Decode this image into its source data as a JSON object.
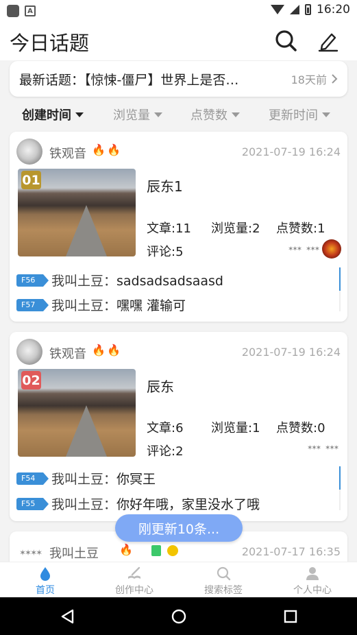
{
  "status": {
    "time": "16:20"
  },
  "header": {
    "title": "今日话题",
    "search_icon": "search-icon",
    "edit_icon": "pencil-icon"
  },
  "notice": {
    "text": "最新话题：【惊悚-僵尸】世界上是否…",
    "time": "18天前"
  },
  "sort": {
    "items": [
      "创建时间",
      "浏览量",
      "点赞数",
      "更新时间"
    ],
    "active": "创建时间"
  },
  "cards": [
    {
      "author": "铁观音",
      "date": "2021-07-19 16:24",
      "rank": "01",
      "rank_color": "#b8962e",
      "title": "辰东1",
      "articles": "文章:11",
      "views": "浏览量:2",
      "likes": "点赞数:1",
      "comments": "评论:5",
      "floors": [
        {
          "tag": "F56",
          "who": "我叫土豆：",
          "text": "sadsadsadsaasd"
        },
        {
          "tag": "F57",
          "who": "我叫土豆：",
          "text": "嘿嘿 灌输可"
        }
      ]
    },
    {
      "author": "铁观音",
      "date": "2021-07-19 16:24",
      "rank": "02",
      "rank_color": "#e05a5a",
      "title": "辰东",
      "articles": "文章:6",
      "views": "浏览量:1",
      "likes": "点赞数:0",
      "comments": "评论:2",
      "floors": [
        {
          "tag": "F54",
          "who": "我叫土豆：",
          "text": "你冥王"
        },
        {
          "tag": "F55",
          "who": "我叫土豆：",
          "text": "你好年哦，家里没水了哦"
        }
      ]
    },
    {
      "author": "我叫土豆",
      "date": "2021-07-17 16:35"
    }
  ],
  "toast": "刚更新10条...",
  "tabs": [
    {
      "label": "首页",
      "icon": "drop-icon"
    },
    {
      "label": "创作中心",
      "icon": "book-pen-icon"
    },
    {
      "label": "搜索标签",
      "icon": "search-icon"
    },
    {
      "label": "个人中心",
      "icon": "person-icon"
    }
  ],
  "colors": {
    "accent": "#2f8be0",
    "toast": "#7fa9f5",
    "fire": "#e74c3c"
  }
}
